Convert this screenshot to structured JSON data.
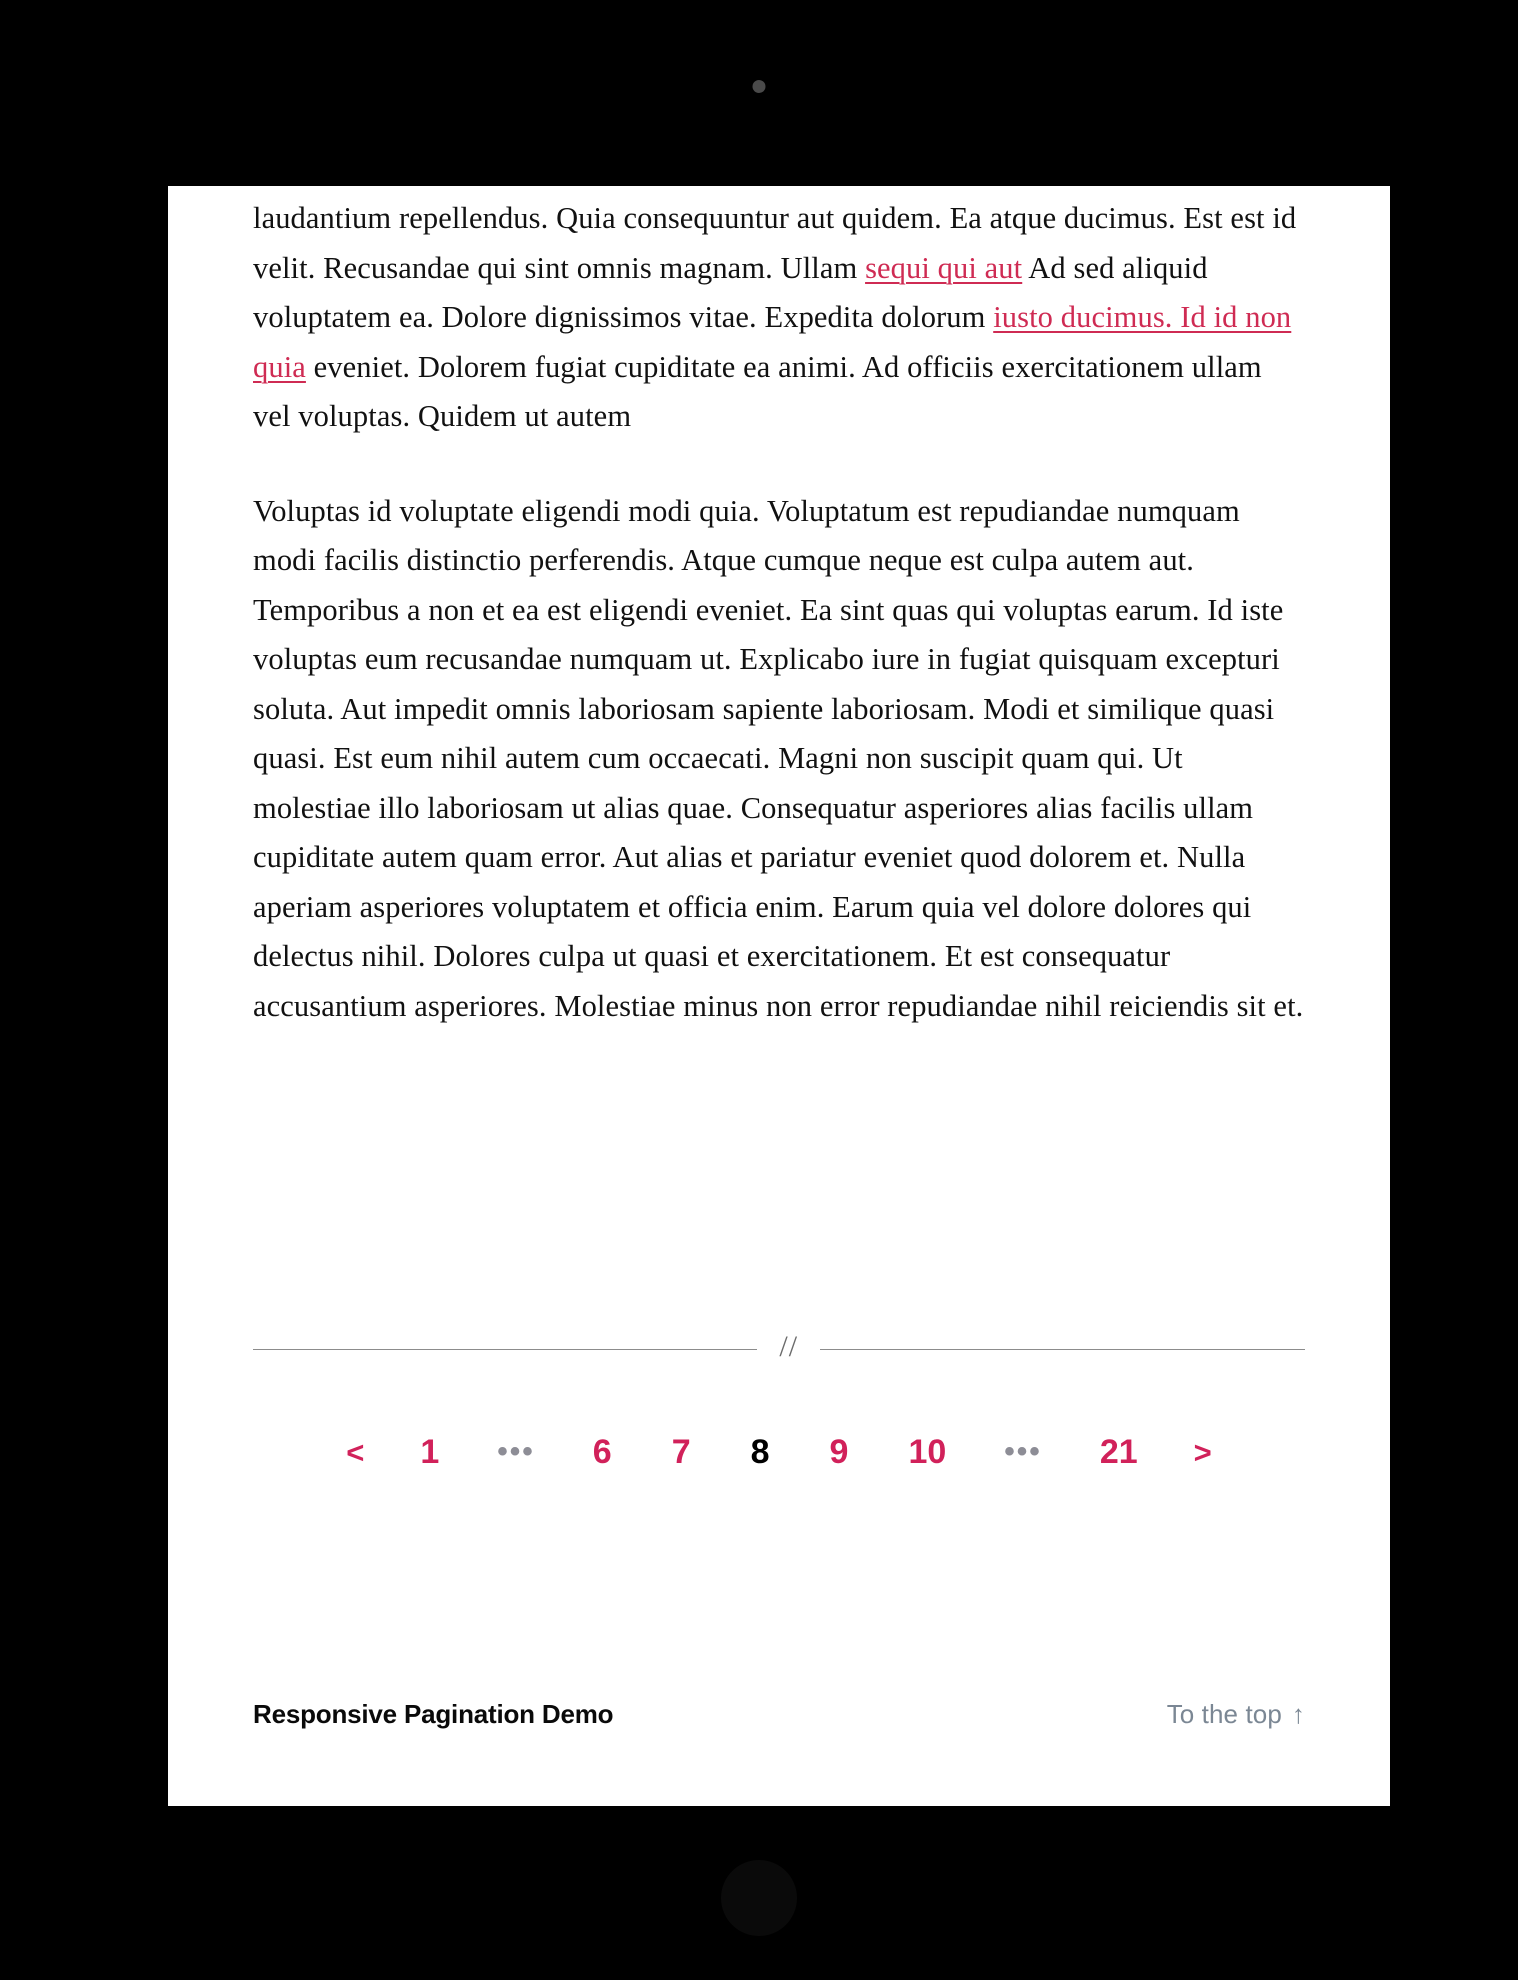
{
  "device": {
    "camera_icon": "camera-dot",
    "home_icon": "home-button"
  },
  "article": {
    "paragraph1": {
      "seg1": "laudantium repellendus. Quia consequuntur aut quidem. Ea atque ducimus. Est est id velit. Recusandae qui sint omnis magnam. Ullam ",
      "link1": "sequi qui aut",
      "seg2": " Ad sed aliquid voluptatem ea. Dolore dignissimos vitae. Expedita dolorum ",
      "link2": "iusto ducimus. Id id non quia",
      "seg3": " eveniet. Dolorem fugiat cupiditate ea animi. Ad officiis exercitationem ullam vel voluptas. Quidem ut autem"
    },
    "paragraph2": "Voluptas id voluptate eligendi modi quia. Voluptatum est repudiandae numquam modi facilis distinctio perferendis. Atque cumque neque est culpa autem aut. Temporibus a non et ea est eligendi eveniet. Ea sint quas qui voluptas earum. Id iste voluptas eum recusandae numquam ut. Explicabo iure in fugiat quisquam excepturi soluta. Aut impedit omnis laboriosam sapiente laboriosam. Modi et similique quasi quasi. Est eum nihil autem cum occaecati. Magni non suscipit quam qui. Ut molestiae illo laboriosam ut alias quae. Consequatur asperiores alias facilis ullam cupiditate autem quam error. Aut alias et pariatur eveniet quod dolorem et. Nulla aperiam asperiores voluptatem et officia enim. Earum quia vel dolore dolores qui delectus nihil. Dolores culpa ut quasi et exercitationem. Et est consequatur accusantium asperiores. Molestiae minus non error repudiandae nihil reiciendis sit et."
  },
  "divider": {
    "glyph": "//"
  },
  "pagination": {
    "prev_label": "<",
    "next_label": ">",
    "ellipsis": "•••",
    "current_page": 8,
    "total_pages": 21,
    "items": [
      {
        "type": "arrow",
        "label": "<",
        "name": "pagination-prev"
      },
      {
        "type": "page",
        "label": "1",
        "name": "pagination-page-1"
      },
      {
        "type": "ellipsis",
        "label": "•••",
        "name": "pagination-ellipsis-start"
      },
      {
        "type": "page",
        "label": "6",
        "name": "pagination-page-6"
      },
      {
        "type": "page",
        "label": "7",
        "name": "pagination-page-7"
      },
      {
        "type": "current",
        "label": "8",
        "name": "pagination-page-8-current"
      },
      {
        "type": "page",
        "label": "9",
        "name": "pagination-page-9"
      },
      {
        "type": "page",
        "label": "10",
        "name": "pagination-page-10"
      },
      {
        "type": "ellipsis",
        "label": "•••",
        "name": "pagination-ellipsis-end"
      },
      {
        "type": "page",
        "label": "21",
        "name": "pagination-page-21"
      },
      {
        "type": "arrow",
        "label": ">",
        "name": "pagination-next"
      }
    ]
  },
  "footer": {
    "brand": "Responsive Pagination Demo",
    "to_top_label": "To the top",
    "to_top_icon": "arrow-up-icon",
    "to_top_arrow": "↑"
  },
  "colors": {
    "accent": "#d1215a",
    "link": "#cf2b53",
    "text": "#111111",
    "muted": "#8d8d96",
    "footer_link": "#7b8794",
    "page_bg": "#ffffff",
    "device_bg": "#000000",
    "rule": "#8c8c8c"
  }
}
